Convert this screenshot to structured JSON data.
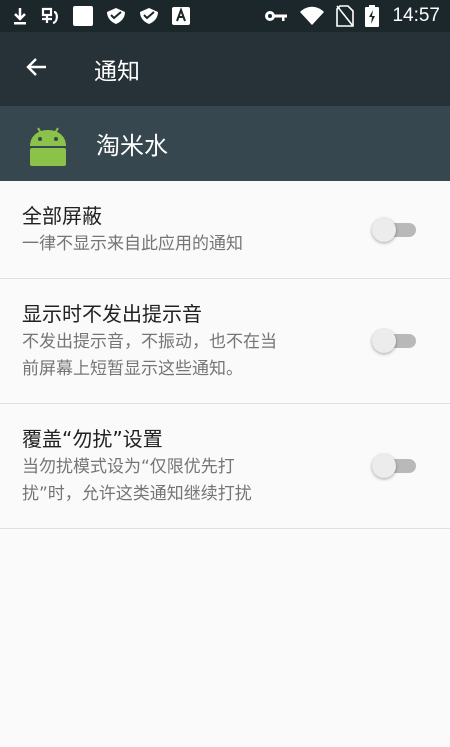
{
  "status_bar": {
    "time": "14:57",
    "left_icons": [
      "download-icon",
      "app-notification-icon",
      "white-square-icon",
      "shield-icon",
      "shield-icon",
      "a-box-icon"
    ],
    "right_icons": [
      "key-icon",
      "wifi-icon",
      "no-sim-icon",
      "battery-charging-icon"
    ]
  },
  "app_bar": {
    "title": "通知",
    "back_icon": "arrow-back-icon"
  },
  "app_header": {
    "name": "淘米水",
    "icon": "android-icon"
  },
  "settings": [
    {
      "title": "全部屏蔽",
      "summary": "一律不显示来自此应用的通知",
      "enabled": false
    },
    {
      "title": "显示时不发出提示音",
      "summary": "不发出提示音，不振动，也不在当\n前屏幕上短暂显示这些通知。",
      "enabled": false
    },
    {
      "title": "覆盖“勿扰”设置",
      "summary": "当勿扰模式设为“仅限优先打\n扰”时，允许这类通知继续打扰",
      "enabled": false
    }
  ],
  "colors": {
    "status_bar": "#1c272b",
    "app_bar": "#263238",
    "app_header": "#37474f",
    "background": "#fafafa",
    "android_green": "#8bc34a"
  }
}
